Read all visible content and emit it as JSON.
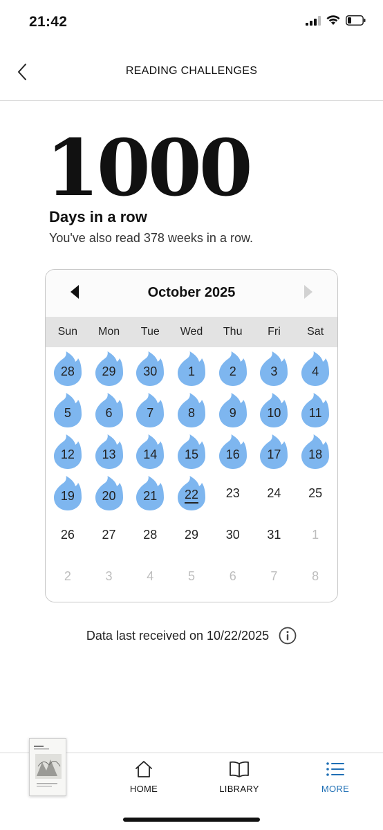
{
  "status_bar": {
    "time": "21:42"
  },
  "header": {
    "title": "READING CHALLENGES"
  },
  "streak": {
    "number": "1000",
    "label": "Days in a row",
    "subtitle": "You've also read 378 weeks in a row."
  },
  "calendar": {
    "month_label": "October 2025",
    "weekdays": [
      "Sun",
      "Mon",
      "Tue",
      "Wed",
      "Thu",
      "Fri",
      "Sat"
    ],
    "flame_color": "#7eb6ef",
    "days": [
      {
        "label": "28",
        "read": true,
        "faded": false,
        "today": false
      },
      {
        "label": "29",
        "read": true,
        "faded": false,
        "today": false
      },
      {
        "label": "30",
        "read": true,
        "faded": false,
        "today": false
      },
      {
        "label": "1",
        "read": true,
        "faded": false,
        "today": false
      },
      {
        "label": "2",
        "read": true,
        "faded": false,
        "today": false
      },
      {
        "label": "3",
        "read": true,
        "faded": false,
        "today": false
      },
      {
        "label": "4",
        "read": true,
        "faded": false,
        "today": false
      },
      {
        "label": "5",
        "read": true,
        "faded": false,
        "today": false
      },
      {
        "label": "6",
        "read": true,
        "faded": false,
        "today": false
      },
      {
        "label": "7",
        "read": true,
        "faded": false,
        "today": false
      },
      {
        "label": "8",
        "read": true,
        "faded": false,
        "today": false
      },
      {
        "label": "9",
        "read": true,
        "faded": false,
        "today": false
      },
      {
        "label": "10",
        "read": true,
        "faded": false,
        "today": false
      },
      {
        "label": "11",
        "read": true,
        "faded": false,
        "today": false
      },
      {
        "label": "12",
        "read": true,
        "faded": false,
        "today": false
      },
      {
        "label": "13",
        "read": true,
        "faded": false,
        "today": false
      },
      {
        "label": "14",
        "read": true,
        "faded": false,
        "today": false
      },
      {
        "label": "15",
        "read": true,
        "faded": false,
        "today": false
      },
      {
        "label": "16",
        "read": true,
        "faded": false,
        "today": false
      },
      {
        "label": "17",
        "read": true,
        "faded": false,
        "today": false
      },
      {
        "label": "18",
        "read": true,
        "faded": false,
        "today": false
      },
      {
        "label": "19",
        "read": true,
        "faded": false,
        "today": false
      },
      {
        "label": "20",
        "read": true,
        "faded": false,
        "today": false
      },
      {
        "label": "21",
        "read": true,
        "faded": false,
        "today": false
      },
      {
        "label": "22",
        "read": true,
        "faded": false,
        "today": true
      },
      {
        "label": "23",
        "read": false,
        "faded": false,
        "today": false
      },
      {
        "label": "24",
        "read": false,
        "faded": false,
        "today": false
      },
      {
        "label": "25",
        "read": false,
        "faded": false,
        "today": false
      },
      {
        "label": "26",
        "read": false,
        "faded": false,
        "today": false
      },
      {
        "label": "27",
        "read": false,
        "faded": false,
        "today": false
      },
      {
        "label": "28",
        "read": false,
        "faded": false,
        "today": false
      },
      {
        "label": "29",
        "read": false,
        "faded": false,
        "today": false
      },
      {
        "label": "30",
        "read": false,
        "faded": false,
        "today": false
      },
      {
        "label": "31",
        "read": false,
        "faded": false,
        "today": false
      },
      {
        "label": "1",
        "read": false,
        "faded": true,
        "today": false
      },
      {
        "label": "2",
        "read": false,
        "faded": true,
        "today": false
      },
      {
        "label": "3",
        "read": false,
        "faded": true,
        "today": false
      },
      {
        "label": "4",
        "read": false,
        "faded": true,
        "today": false
      },
      {
        "label": "5",
        "read": false,
        "faded": true,
        "today": false
      },
      {
        "label": "6",
        "read": false,
        "faded": true,
        "today": false
      },
      {
        "label": "7",
        "read": false,
        "faded": true,
        "today": false
      },
      {
        "label": "8",
        "read": false,
        "faded": true,
        "today": false
      }
    ]
  },
  "data_status": {
    "text": "Data last received on 10/22/2025",
    "icon": "info-icon"
  },
  "bottom_nav": {
    "items": [
      {
        "label": "HOME",
        "icon": "home-icon",
        "active": false
      },
      {
        "label": "LIBRARY",
        "icon": "book-icon",
        "active": false
      },
      {
        "label": "MORE",
        "icon": "menu-list-icon",
        "active": true
      }
    ],
    "active_color": "#1f6fb5"
  }
}
